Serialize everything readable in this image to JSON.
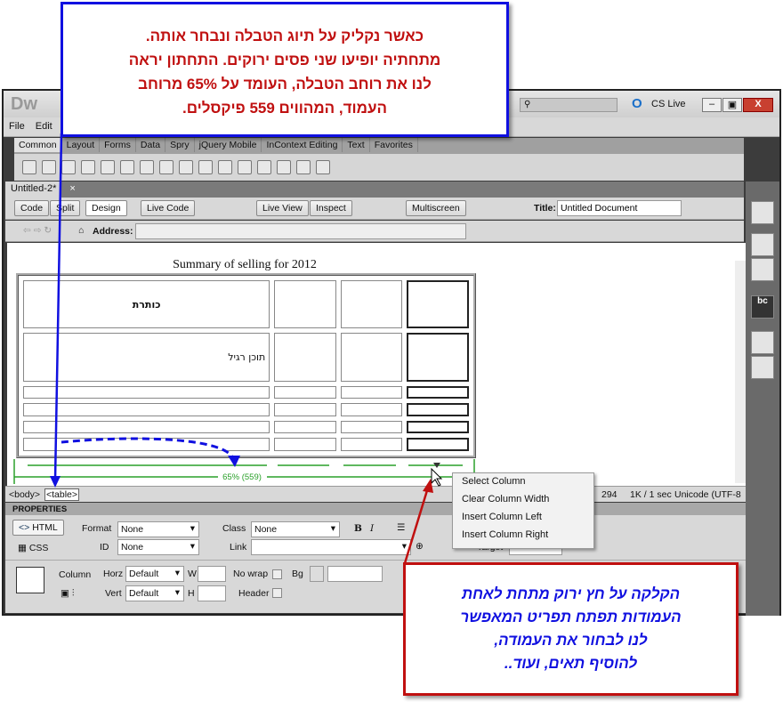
{
  "app": {
    "logo": "Dw",
    "search_placeholder": "",
    "cs_live": "CS Live"
  },
  "menu": [
    "File",
    "Edit"
  ],
  "insert_tabs": [
    "Common",
    "Layout",
    "Forms",
    "Data",
    "Spry",
    "jQuery Mobile",
    "InContext Editing",
    "Text",
    "Favorites"
  ],
  "doc_tab": {
    "label": "Untitled-2*",
    "close": "×"
  },
  "doc_toolbar": {
    "code": "Code",
    "split": "Split",
    "design": "Design",
    "live_code": "Live Code",
    "live_view": "Live View",
    "inspect": "Inspect",
    "multiscreen": "Multiscreen",
    "title_label": "Title:",
    "title_value": "Untitled Document"
  },
  "address": {
    "label": "Address:",
    "value": ""
  },
  "table": {
    "caption": "Summary of selling for 2012",
    "rows": [
      [
        "כותרת",
        "",
        "",
        ""
      ],
      [
        "תוכן רגיל",
        "",
        "",
        ""
      ],
      [
        "",
        "",
        "",
        ""
      ],
      [
        "",
        "",
        "",
        ""
      ],
      [
        "",
        "",
        "",
        ""
      ],
      [
        "",
        "",
        "",
        ""
      ]
    ],
    "width_label": "65% (559)"
  },
  "status": {
    "tags": [
      "<body>",
      "<table>"
    ],
    "size": "294",
    "download": "1K / 1 sec",
    "encoding": "Unicode (UTF-8"
  },
  "properties": {
    "header": "PROPERTIES",
    "html": "HTML",
    "css": "CSS",
    "format_label": "Format",
    "format": "None",
    "class_label": "Class",
    "class": "None",
    "id_label": "ID",
    "id": "None",
    "link_label": "Link",
    "target_label": "Target",
    "column": "Column",
    "horz_label": "Horz",
    "horz": "Default",
    "vert_label": "Vert",
    "vert": "Default",
    "w": "W",
    "h": "H",
    "nowrap": "No wrap",
    "bg": "Bg",
    "header_label": "Header",
    "bold": "B",
    "italic": "I"
  },
  "context_menu": [
    "Select Column",
    "Clear Column Width",
    "Insert Column Left",
    "Insert Column Right"
  ],
  "callout_top": [
    "כאשר נקליק על תיוג הטבלה ונבחר אותה.",
    "מתחתיה יופיעו שני פסים ירוקים. התחתון יראה",
    "לנו את רוחב הטבלה, העומד על 65% מרוחב",
    "העמוד, המהווים 559 פיקסלים."
  ],
  "callout_bottom": [
    "הקלקה על חץ ירוק מתחת לאחת",
    "העמודות תפתח תפריט המאפשר",
    "לנו לבחור את העמודה,",
    "להוסיף תאים, ועוד.."
  ],
  "colors": {
    "callout_top_border": "#1010e0",
    "callout_top_text": "#c01010",
    "callout_bottom_border": "#c01010",
    "callout_bottom_text": "#1010e0",
    "ruler": "#2aa02a"
  }
}
